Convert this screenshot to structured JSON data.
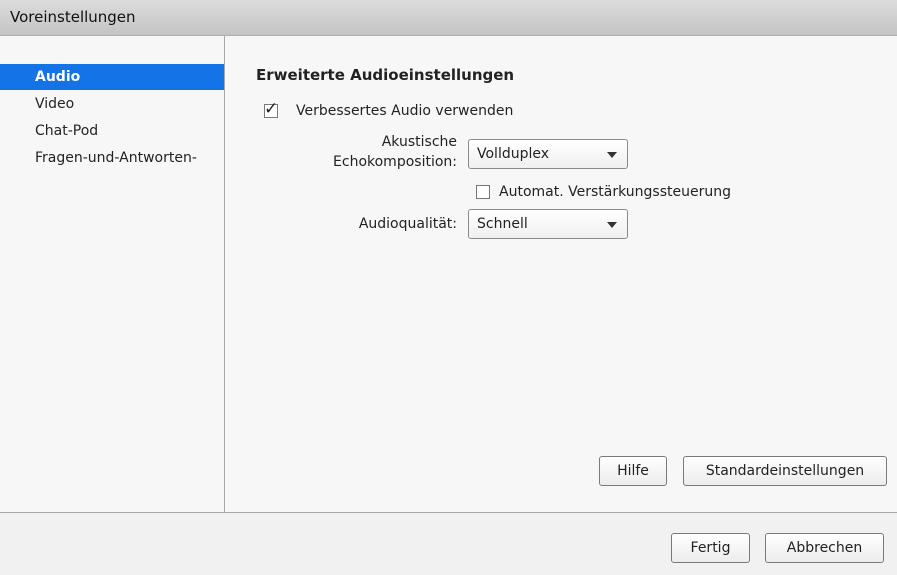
{
  "window": {
    "title": "Voreinstellungen"
  },
  "sidebar": {
    "items": [
      {
        "label": "Audio",
        "selected": true
      },
      {
        "label": "Video",
        "selected": false
      },
      {
        "label": "Chat-Pod",
        "selected": false
      },
      {
        "label": "Fragen-und-Antworten-",
        "selected": false
      }
    ]
  },
  "main": {
    "section_title": "Erweiterte Audioeinstellungen",
    "enhanced_audio": {
      "label": "Verbessertes Audio verwenden",
      "checked": true
    },
    "echo": {
      "label_line1": "Akustische",
      "label_line2": "Echokomposition:",
      "value": "Vollduplex"
    },
    "agc": {
      "label": "Automat. Verstärkungssteuerung",
      "checked": false
    },
    "quality": {
      "label": "Audioqualität:",
      "value": "Schnell"
    },
    "help_label": "Hilfe",
    "defaults_label": "Standardeinstellungen"
  },
  "footer": {
    "done_label": "Fertig",
    "cancel_label": "Abbrechen"
  },
  "colors": {
    "selection": "#1473e6",
    "titlebar": "#c8c8c8"
  },
  "icons": {
    "checkmark": "checkmark-icon",
    "dropdown": "chevron-down-icon"
  }
}
